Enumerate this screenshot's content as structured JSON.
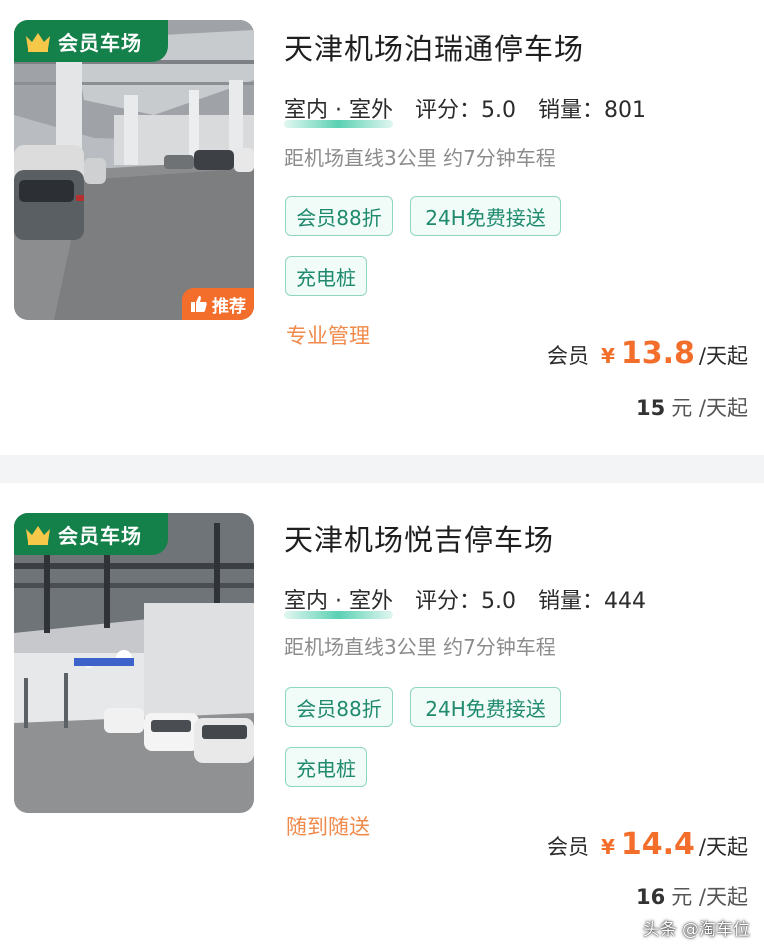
{
  "listings": [
    {
      "badge": "会员车场",
      "recommend_badge": "推荐",
      "title": "天津机场泊瑞通停车场",
      "type": "室内 · 室外",
      "rating_label": "评分：",
      "rating": "5.0",
      "sales_label": "销量：",
      "sales": "801",
      "distance": "距机场直线3公里 约7分钟车程",
      "tags": [
        "会员88折",
        "24H免费接送",
        "充电桩"
      ],
      "note": "专业管理",
      "price_label": "会员",
      "currency": "¥",
      "price": "13.8",
      "price_unit": "/天起",
      "orig_price": "15",
      "orig_unit": "元 /天起"
    },
    {
      "badge": "会员车场",
      "title": "天津机场悦吉停车场",
      "type": "室内 · 室外",
      "rating_label": "评分：",
      "rating": "5.0",
      "sales_label": "销量：",
      "sales": "444",
      "distance": "距机场直线3公里 约7分钟车程",
      "tags": [
        "会员88折",
        "24H免费接送",
        "充电桩"
      ],
      "note": "随到随送",
      "price_label": "会员",
      "currency": "¥",
      "price": "14.4",
      "price_unit": "/天起",
      "orig_price": "16",
      "orig_unit": "元 /天起"
    }
  ],
  "watermark": "头条 @淘车位",
  "colors": {
    "brand_green": "#14804a",
    "accent_orange": "#f36d2b",
    "tag_teal": "#1f8a6d"
  }
}
